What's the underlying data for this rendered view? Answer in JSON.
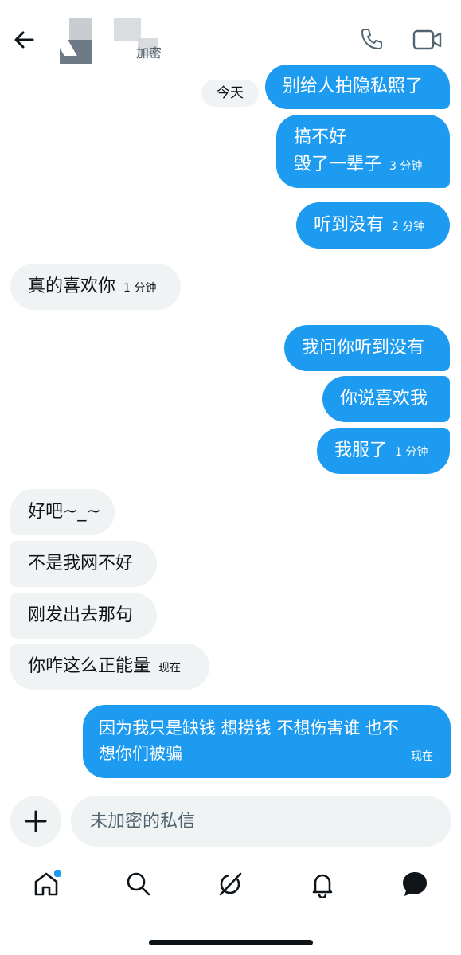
{
  "header": {
    "subtitle": "加密",
    "back_icon": "arrow-left-icon",
    "call_icon": "phone-icon",
    "video_icon": "video-camera-icon"
  },
  "day_label": "今天",
  "messages": [
    {
      "dir": "out",
      "text": "别给人拍隐私照了",
      "time": ""
    },
    {
      "dir": "out",
      "text_lines": [
        "搞不好",
        "毁了一辈子"
      ],
      "time": "3 分钟"
    },
    {
      "dir": "out",
      "text": "听到没有",
      "time": "2 分钟"
    },
    {
      "dir": "in",
      "text": "真的喜欢你",
      "time": "1 分钟"
    },
    {
      "dir": "out",
      "text": "我问你听到没有",
      "time": ""
    },
    {
      "dir": "out",
      "text": "你说喜欢我",
      "time": ""
    },
    {
      "dir": "out",
      "text": "我服了",
      "time": "1 分钟"
    },
    {
      "dir": "in",
      "text": "好吧~_~",
      "time": ""
    },
    {
      "dir": "in",
      "text": "不是我网不好",
      "time": ""
    },
    {
      "dir": "in",
      "text": "刚发出去那句",
      "time": ""
    },
    {
      "dir": "in",
      "text": "你咋这么正能量",
      "time": "现在"
    },
    {
      "dir": "out",
      "text_lines": [
        "因为我只是缺钱 想捞钱 不想伤害谁 也不",
        "想你们被骗"
      ],
      "time": "现在"
    }
  ],
  "composer": {
    "placeholder": "未加密的私信",
    "add_icon": "plus-icon"
  },
  "tabbar": {
    "items": [
      "home-icon",
      "search-icon",
      "grok-icon",
      "bell-icon",
      "messages-icon"
    ],
    "active": "messages-icon",
    "badge_color": "#1d9bf0"
  },
  "colors": {
    "outgoing_bubble": "#1d9bf0",
    "incoming_bubble": "#eff3f4",
    "text_primary": "#0f1419",
    "text_secondary": "#536471"
  }
}
